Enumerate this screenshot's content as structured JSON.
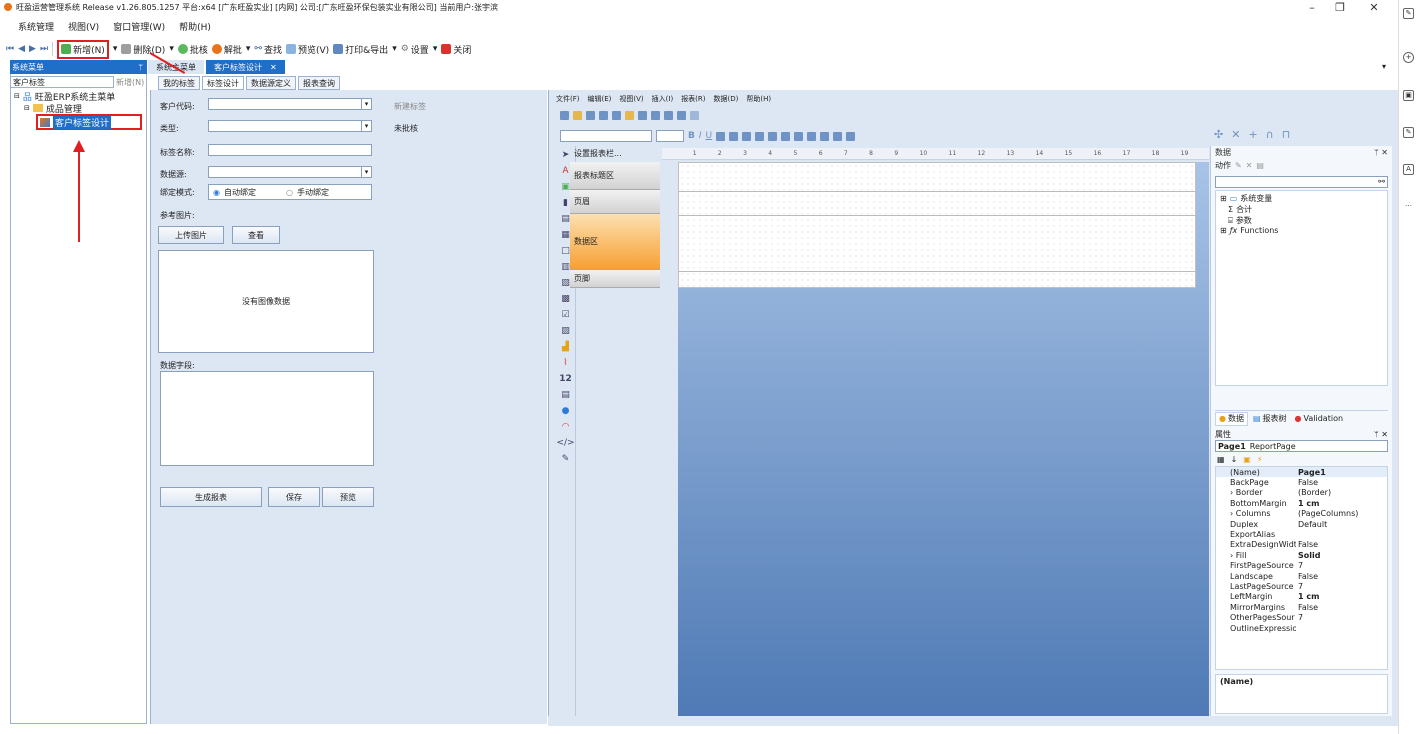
{
  "window": {
    "title": "旺盈运营管理系统 Release v1.26.805.1257 平台:x64 [广东旺盈实业] [内网] 公司:[广东旺盈环保包装实业有限公司] 当前用户:张宇滨"
  },
  "menubar": [
    "系统管理",
    "视图(V)",
    "窗口管理(W)",
    "帮助(H)"
  ],
  "toolbar": {
    "add_label": "新增(N)",
    "delete_label": "删除(D)",
    "approve_label": "批核",
    "unapprove_label": "解批",
    "search_label": "查找",
    "preview_label": "预览(V)",
    "print_label": "打印&导出",
    "settings_label": "设置",
    "close_label": "关闭"
  },
  "left_nav": {
    "header": "系统菜单",
    "search_value": "客户标签",
    "new_label": "新增(N)",
    "tree_root": "旺盈ERP系统主菜单",
    "tree_child": "成品管理",
    "tree_leaf": "客户标签设计"
  },
  "tabs": [
    {
      "label": "系统主菜单"
    },
    {
      "label": "客户标签设计"
    }
  ],
  "subtabs": [
    "我的标签",
    "标签设计",
    "数据源定义",
    "报表查询"
  ],
  "form": {
    "customer_code_label": "客户代码:",
    "new_tag_label": "新建标签",
    "type_label": "类型:",
    "status_label": "未批核",
    "tag_name_label": "标签名称:",
    "datasource_label": "数据源:",
    "bind_mode_label": "绑定模式:",
    "auto_bind_label": "自动绑定",
    "manual_bind_label": "手动绑定",
    "ref_image_label": "参考图片:",
    "upload_label": "上传图片",
    "view_label": "查看",
    "no_image_text": "没有图像数据",
    "fields_label": "数据字段:",
    "generate_label": "生成报表",
    "save_label": "保存",
    "preview_label": "预览"
  },
  "designer": {
    "menu": [
      "文件(F)",
      "编辑(E)",
      "视图(V)",
      "插入(I)",
      "报表(R)",
      "数据(D)",
      "帮助(H)"
    ],
    "band_header": "设置报表栏...",
    "bands": [
      "报表标题区",
      "页眉",
      "数据区",
      "页脚"
    ],
    "ruler_ticks": [
      "1",
      "2",
      "3",
      "4",
      "5",
      "6",
      "7",
      "8",
      "9",
      "10",
      "11",
      "12",
      "13",
      "14",
      "15",
      "16",
      "17",
      "18",
      "19"
    ]
  },
  "data_panel": {
    "title": "数据",
    "actions_label": "动作",
    "tree": [
      "系统变量",
      "合计",
      "参数",
      "Functions"
    ],
    "tabs": [
      "数据",
      "报表树",
      "Validation"
    ]
  },
  "props_panel": {
    "title": "属性",
    "object": "Page1",
    "object_type": "ReportPage",
    "rows": [
      {
        "name": "(Name)",
        "value": "Page1",
        "bold": true
      },
      {
        "name": "BackPage",
        "value": "False"
      },
      {
        "name": "Border",
        "value": "(Border)",
        "expand": true
      },
      {
        "name": "BottomMargin",
        "value": "1 cm",
        "bold": true
      },
      {
        "name": "Columns",
        "value": "(PageColumns)",
        "expand": true
      },
      {
        "name": "Duplex",
        "value": "Default"
      },
      {
        "name": "ExportAlias",
        "value": ""
      },
      {
        "name": "ExtraDesignWidt",
        "value": "False"
      },
      {
        "name": "Fill",
        "value": "Solid",
        "bold": true,
        "expand": true
      },
      {
        "name": "FirstPageSource",
        "value": "7"
      },
      {
        "name": "Landscape",
        "value": "False"
      },
      {
        "name": "LastPageSource",
        "value": "7"
      },
      {
        "name": "LeftMargin",
        "value": "1 cm",
        "bold": true
      },
      {
        "name": "MirrorMargins",
        "value": "False"
      },
      {
        "name": "OtherPagesSour",
        "value": "7"
      },
      {
        "name": "OutlineExpressio",
        "value": ""
      }
    ],
    "footer": "(Name)"
  }
}
